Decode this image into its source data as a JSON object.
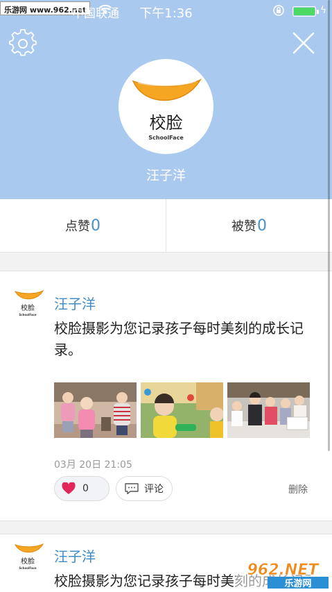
{
  "status_bar": {
    "watermark": "乐游网 www.962.net",
    "carrier": "中国联通",
    "time": "下午1:36",
    "battery_percent": 100
  },
  "header": {
    "brand_name": "校脸",
    "brand_sub": "SchoolFace",
    "username": "汪子洋"
  },
  "stats": {
    "likes_given_label": "点赞",
    "likes_given_value": "0",
    "likes_received_label": "被赞",
    "likes_received_value": "0"
  },
  "posts": [
    {
      "author": "汪子洋",
      "logo_text": "校脸",
      "logo_sub": "SchoolFace",
      "text": "校脸摄影为您记录孩子每时美刻的成长记录。",
      "date": "03月 20日 21:05",
      "like_count": "0",
      "comment_label": "评论",
      "delete_label": "删除"
    },
    {
      "author": "汪子洋",
      "logo_text": "校脸",
      "logo_sub": "SchoolFace",
      "text": "校脸摄影为您记录孩子每时美刻的成长记录。"
    }
  ],
  "watermark_logo": {
    "top": "962.NET",
    "bottom": "乐游网"
  },
  "colors": {
    "header_bg": "#a9c9ee",
    "accent_blue": "#3f8cc7",
    "heart_red": "#e0265a",
    "logo_orange": "#f5a623"
  }
}
